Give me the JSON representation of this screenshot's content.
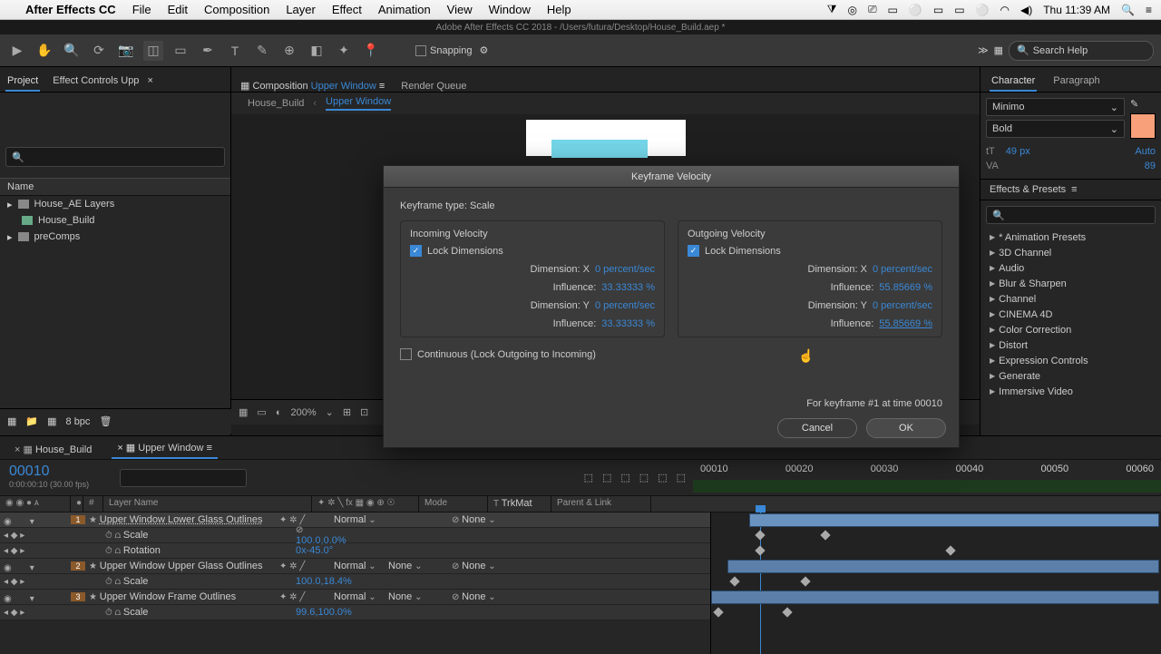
{
  "mac": {
    "app": "After Effects CC",
    "menus": [
      "File",
      "Edit",
      "Composition",
      "Layer",
      "Effect",
      "Animation",
      "View",
      "Window",
      "Help"
    ],
    "clock": "Thu 11:39 AM"
  },
  "window_title": "Adobe After Effects CC 2018 - /Users/futura/Desktop/House_Build.aep *",
  "toolbar": {
    "snapping": "Snapping",
    "search_help_ph": "Search Help"
  },
  "project": {
    "tab_project": "Project",
    "tab_effect_controls": "Effect Controls Upp",
    "name_header": "Name",
    "items": [
      "House_AE Layers",
      "House_Build",
      "preComps"
    ],
    "bpc": "8 bpc"
  },
  "comp": {
    "tab_comp_prefix": "Composition",
    "tab_comp_name": "Upper Window",
    "tab_render": "Render Queue",
    "crumb1": "House_Build",
    "crumb2": "Upper Window",
    "zoom": "200%"
  },
  "character": {
    "tab_char": "Character",
    "tab_para": "Paragraph",
    "font": "Minimo",
    "weight": "Bold",
    "size_lbl": "tT",
    "size_val": "49 px",
    "lead_lbl": "Auto",
    "track_lbl": "VA",
    "track_val": "89"
  },
  "effects": {
    "title": "Effects & Presets",
    "items": [
      "* Animation Presets",
      "3D Channel",
      "Audio",
      "Blur & Sharpen",
      "Channel",
      "CINEMA 4D",
      "Color Correction",
      "Distort",
      "Expression Controls",
      "Generate",
      "Immersive Video"
    ]
  },
  "timeline": {
    "tab1": "House_Build",
    "tab2": "Upper Window",
    "timecode": "00010",
    "timecode_sub": "0:00:00:10 (30.00 fps)",
    "ruler": [
      "00010",
      "00020",
      "00030",
      "00040",
      "00050",
      "00060"
    ],
    "col_layer": "Layer Name",
    "col_mode": "Mode",
    "col_trk": "TrkMat",
    "col_parent": "Parent & Link",
    "normal": "Normal",
    "none": "None",
    "layers": [
      {
        "num": "1",
        "name": "Upper Window Lower Glass Outlines",
        "props": [
          {
            "n": "Scale",
            "v": "100.0,0.0%"
          },
          {
            "n": "Rotation",
            "v": "0x-45.0°"
          }
        ]
      },
      {
        "num": "2",
        "name": "Upper Window Upper Glass Outlines",
        "props": [
          {
            "n": "Scale",
            "v": "100.0,18.4%"
          }
        ]
      },
      {
        "num": "3",
        "name": "Upper Window Frame Outlines",
        "props": [
          {
            "n": "Scale",
            "v": "99.6,100.0%"
          }
        ]
      }
    ]
  },
  "dialog": {
    "title": "Keyframe Velocity",
    "kf_type": "Keyframe type: Scale",
    "incoming": "Incoming Velocity",
    "outgoing": "Outgoing Velocity",
    "lock": "Lock Dimensions",
    "dimx": "Dimension: X",
    "dimy": "Dimension: Y",
    "ps": "0 percent/sec",
    "infl": "Influence:",
    "in_infl": "33.33333 %",
    "out_infl": "55.85669 %",
    "continuous": "Continuous (Lock Outgoing to Incoming)",
    "for_kf": "For keyframe #1 at time 00010",
    "cancel": "Cancel",
    "ok": "OK"
  }
}
